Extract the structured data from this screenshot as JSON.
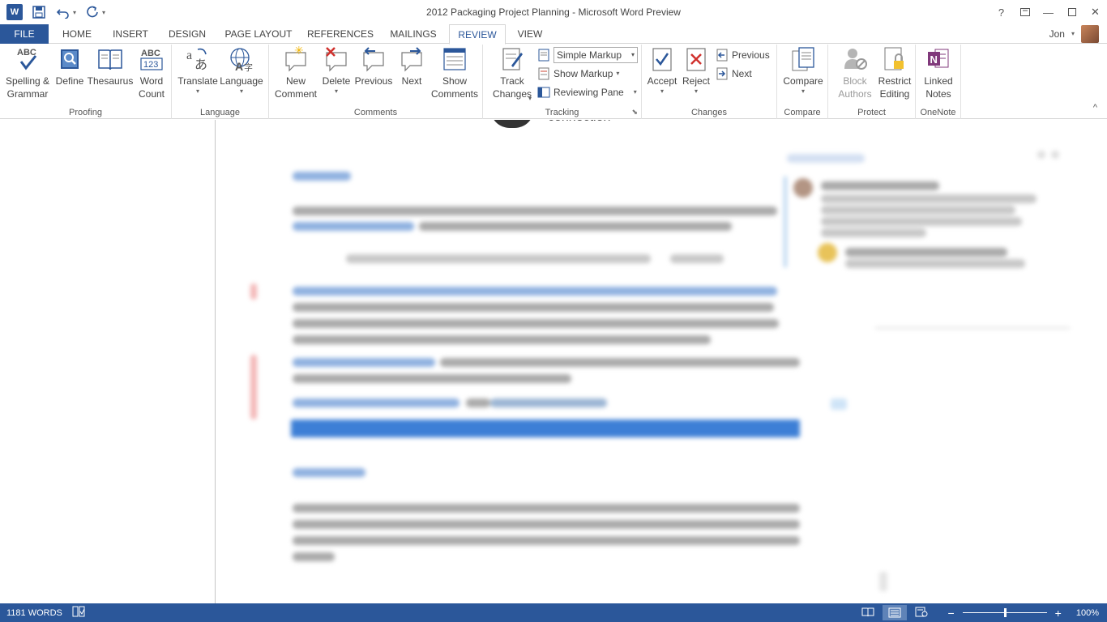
{
  "window": {
    "title": "2012 Packaging Project Planning - Microsoft Word Preview",
    "app_icon": "W",
    "controls": [
      "?",
      "restore-ribbon",
      "minimize",
      "maximize",
      "close"
    ]
  },
  "qat": {
    "save": "save-icon",
    "undo": "undo-icon",
    "redo": "redo-icon",
    "customize": "customize-icon"
  },
  "tabs": [
    {
      "label": "FILE"
    },
    {
      "label": "HOME"
    },
    {
      "label": "INSERT"
    },
    {
      "label": "DESIGN"
    },
    {
      "label": "PAGE LAYOUT"
    },
    {
      "label": "REFERENCES"
    },
    {
      "label": "MAILINGS"
    },
    {
      "label": "REVIEW",
      "active": true
    },
    {
      "label": "VIEW"
    }
  ],
  "user": {
    "name": "Jon"
  },
  "ribbon": {
    "proofing": {
      "label": "Proofing",
      "spelling": "Spelling &",
      "spelling2": "Grammar",
      "define": "Define",
      "thesaurus": "Thesaurus",
      "wordcount": "Word",
      "wordcount2": "Count",
      "abc": "ABC",
      "abc123": "123"
    },
    "language": {
      "label": "Language",
      "translate": "Translate",
      "language": "Language"
    },
    "comments": {
      "label": "Comments",
      "new": "New",
      "new2": "Comment",
      "delete": "Delete",
      "previous": "Previous",
      "next": "Next",
      "show": "Show",
      "show2": "Comments"
    },
    "tracking": {
      "label": "Tracking",
      "track": "Track",
      "track2": "Changes",
      "markup_select": "Simple Markup",
      "show_markup": "Show Markup",
      "reviewing_pane": "Reviewing Pane"
    },
    "changes": {
      "label": "Changes",
      "accept": "Accept",
      "reject": "Reject",
      "previous": "Previous",
      "next": "Next"
    },
    "compare": {
      "label": "Compare",
      "compare": "Compare"
    },
    "protect": {
      "label": "Protect",
      "block": "Block",
      "block2": "Authors",
      "restrict": "Restrict",
      "restrict2": "Editing"
    },
    "onenote": {
      "label": "OneNote",
      "linked": "Linked",
      "linked2": "Notes"
    }
  },
  "document": {
    "partial_heading": "connection"
  },
  "status": {
    "words": "1181 WORDS",
    "zoom": "100%",
    "zoom_fraction": 0.5
  },
  "colors": {
    "accent": "#2b579a",
    "highlight": "#3d7fd6",
    "comment_mark": "#f3b5b5"
  }
}
